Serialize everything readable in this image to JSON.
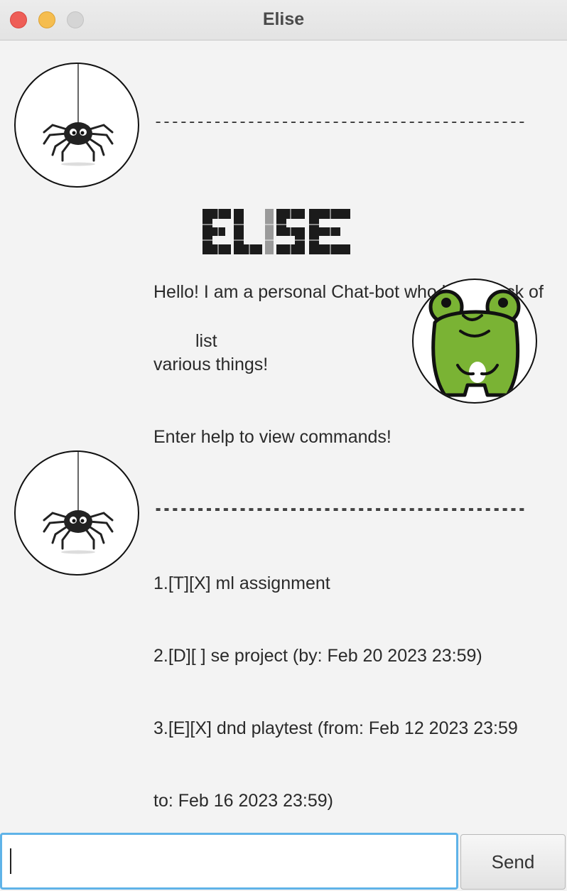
{
  "window": {
    "title": "Elise"
  },
  "messages": {
    "bot_greeting": {
      "divider_top": "------------------------------------------------",
      "logo_text": "ELISE",
      "line1": "Hello! I am a personal Chat-bot who keep track of",
      "line2": "various things!",
      "line3": "Enter help to view commands!",
      "divider_bottom": "------------------------------------------------",
      "avatar_icon": "spider-icon"
    },
    "user_command": {
      "text": "list",
      "avatar_icon": "frog-icon"
    },
    "bot_list": {
      "divider_top": "------------------------------------------------",
      "item1": "1.[T][X] ml assignment",
      "item2": "2.[D][ ] se project (by: Feb 20 2023 23:59)",
      "item3a": "3.[E][X] dnd playtest (from: Feb 12 2023 23:59",
      "item3b": "to: Feb 16 2023 23:59)",
      "divider_bottom": "------------------------------------------------",
      "avatar_icon": "spider-icon"
    }
  },
  "input_bar": {
    "value": "",
    "send_label": "Send"
  },
  "colors": {
    "close": "#ee5e57",
    "minimize": "#f5bd4f",
    "maximize": "#d5d5d5",
    "input_focus": "#5fb3e8",
    "frog_green": "#7ab334"
  }
}
